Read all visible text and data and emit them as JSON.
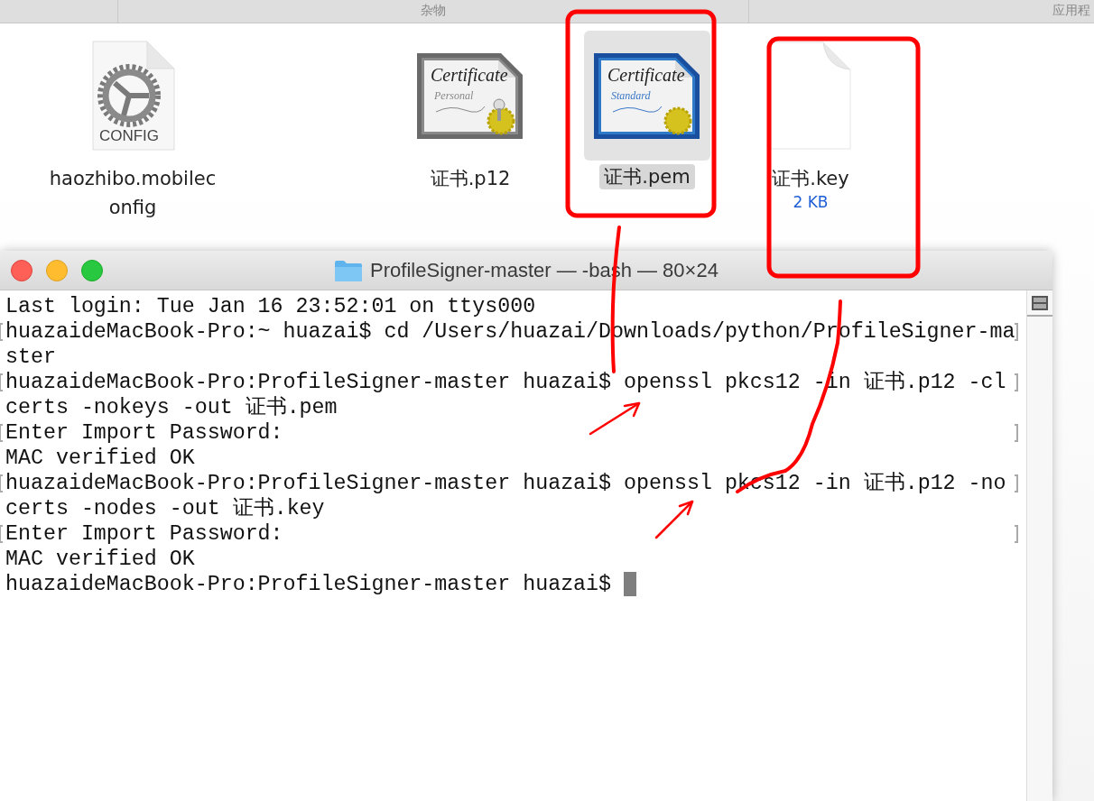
{
  "finder": {
    "columns": [
      {
        "label": "杂物"
      },
      {
        "label": "应用程"
      }
    ],
    "files": [
      {
        "kind": "config",
        "icon_text": "CONFIG",
        "name_lines": [
          "haozhibo.mobilec",
          "onfig"
        ],
        "selected": false
      },
      {
        "kind": "personal-certificate",
        "icon_title": "Certificate",
        "icon_subtitle": "Personal",
        "name_lines": [
          "证书.p12"
        ],
        "selected": false
      },
      {
        "kind": "standard-certificate",
        "icon_title": "Certificate",
        "icon_subtitle": "Standard",
        "name_lines": [
          "证书.pem"
        ],
        "selected": true
      },
      {
        "kind": "blank",
        "name_lines": [
          "证书.key"
        ],
        "size": "2 KB",
        "selected": false
      }
    ]
  },
  "terminal": {
    "title": "ProfileSigner-master — -bash — 80×24",
    "lines": [
      {
        "text": "Last login: Tue Jan 16 23:52:01 on ttys000",
        "marked": false,
        "cursor": false
      },
      {
        "text": "huazaideMacBook-Pro:~ huazai$ cd /Users/huazai/Downloads/python/ProfileSigner-ma",
        "marked": true,
        "cursor": false
      },
      {
        "text": "ster",
        "marked": false,
        "cursor": false
      },
      {
        "text": "huazaideMacBook-Pro:ProfileSigner-master huazai$ openssl pkcs12 -in 证书.p12 -cl",
        "marked": true,
        "cursor": false
      },
      {
        "text": "certs -nokeys -out 证书.pem",
        "marked": false,
        "cursor": false
      },
      {
        "text": "Enter Import Password:",
        "marked": true,
        "cursor": false
      },
      {
        "text": "MAC verified OK",
        "marked": false,
        "cursor": false
      },
      {
        "text": "huazaideMacBook-Pro:ProfileSigner-master huazai$ openssl pkcs12 -in 证书.p12 -no",
        "marked": true,
        "cursor": false
      },
      {
        "text": "certs -nodes -out 证书.key",
        "marked": false,
        "cursor": false
      },
      {
        "text": "Enter Import Password:",
        "marked": true,
        "cursor": false
      },
      {
        "text": "MAC verified OK",
        "marked": false,
        "cursor": false
      },
      {
        "text": "huazaideMacBook-Pro:ProfileSigner-master huazai$ ",
        "marked": false,
        "cursor": true
      }
    ]
  }
}
